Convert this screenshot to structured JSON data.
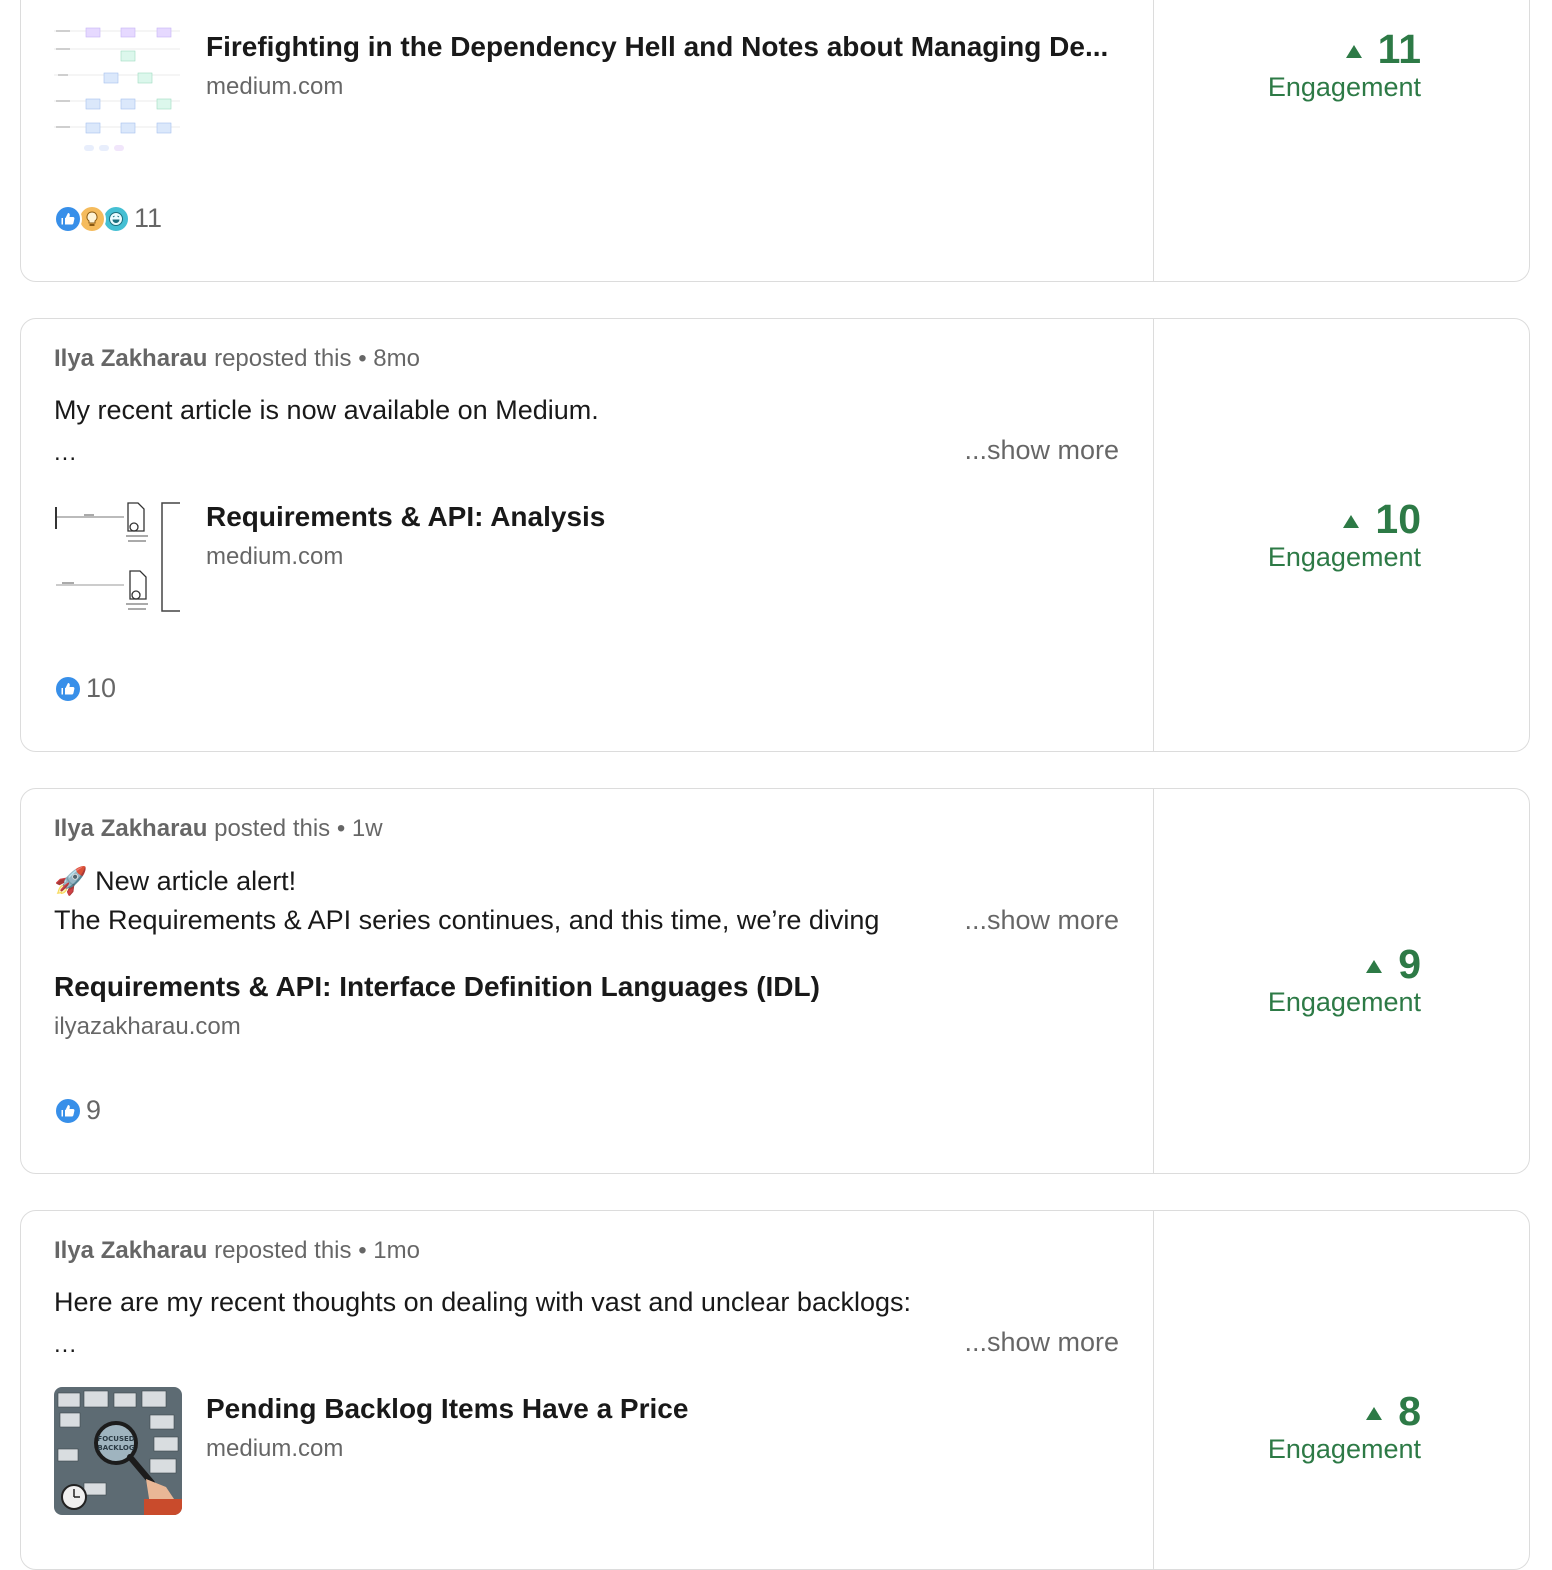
{
  "posts": [
    {
      "article_title": "Firefighting in the Dependency Hell and Notes about Managing De...",
      "article_domain": "medium.com",
      "reactions_count": "11",
      "reaction_icons": [
        "like-icon",
        "insightful-icon",
        "funny-icon"
      ],
      "engagement_value": "11",
      "engagement_label": "Engagement",
      "thumbnail": "dependency-diagram-thumbnail"
    },
    {
      "author": "Ilya Zakharau",
      "action": "reposted this",
      "separator": "•",
      "time": "8mo",
      "commentary": "My recent article is now available on Medium.",
      "ellipsis": "...",
      "show_more": "...show more",
      "article_title": "Requirements & API: Analysis",
      "article_domain": "medium.com",
      "reactions_count": "10",
      "reaction_icons": [
        "like-icon"
      ],
      "engagement_value": "10",
      "engagement_label": "Engagement",
      "thumbnail": "api-analysis-diagram-thumbnail"
    },
    {
      "author": "Ilya Zakharau",
      "action": "posted this",
      "separator": "•",
      "time": "1w",
      "commentary_line1": "🚀 New article alert!",
      "commentary_line2": "The Requirements & API series continues, and this time, we’re diving",
      "show_more": "...show more",
      "article_title": "Requirements & API: Interface Definition Languages (IDL)",
      "article_domain": "ilyazakharau.com",
      "reactions_count": "9",
      "reaction_icons": [
        "like-icon"
      ],
      "engagement_value": "9",
      "engagement_label": "Engagement"
    },
    {
      "author": "Ilya Zakharau",
      "action": "reposted this",
      "separator": "•",
      "time": "1mo",
      "commentary": "Here are my recent thoughts on dealing with vast and unclear backlogs:",
      "ellipsis": "...",
      "show_more": "...show more",
      "article_title": "Pending Backlog Items Have a Price",
      "article_domain": "medium.com",
      "engagement_value": "8",
      "engagement_label": "Engagement",
      "thumbnail": "backlog-magnifier-thumbnail"
    }
  ],
  "colors": {
    "engagement_green": "#2d7a46",
    "border": "#dcdcdc",
    "like_blue": "#378fe9",
    "insightful_yellow": "#f5bb5c",
    "funny_teal": "#44bfd3"
  }
}
